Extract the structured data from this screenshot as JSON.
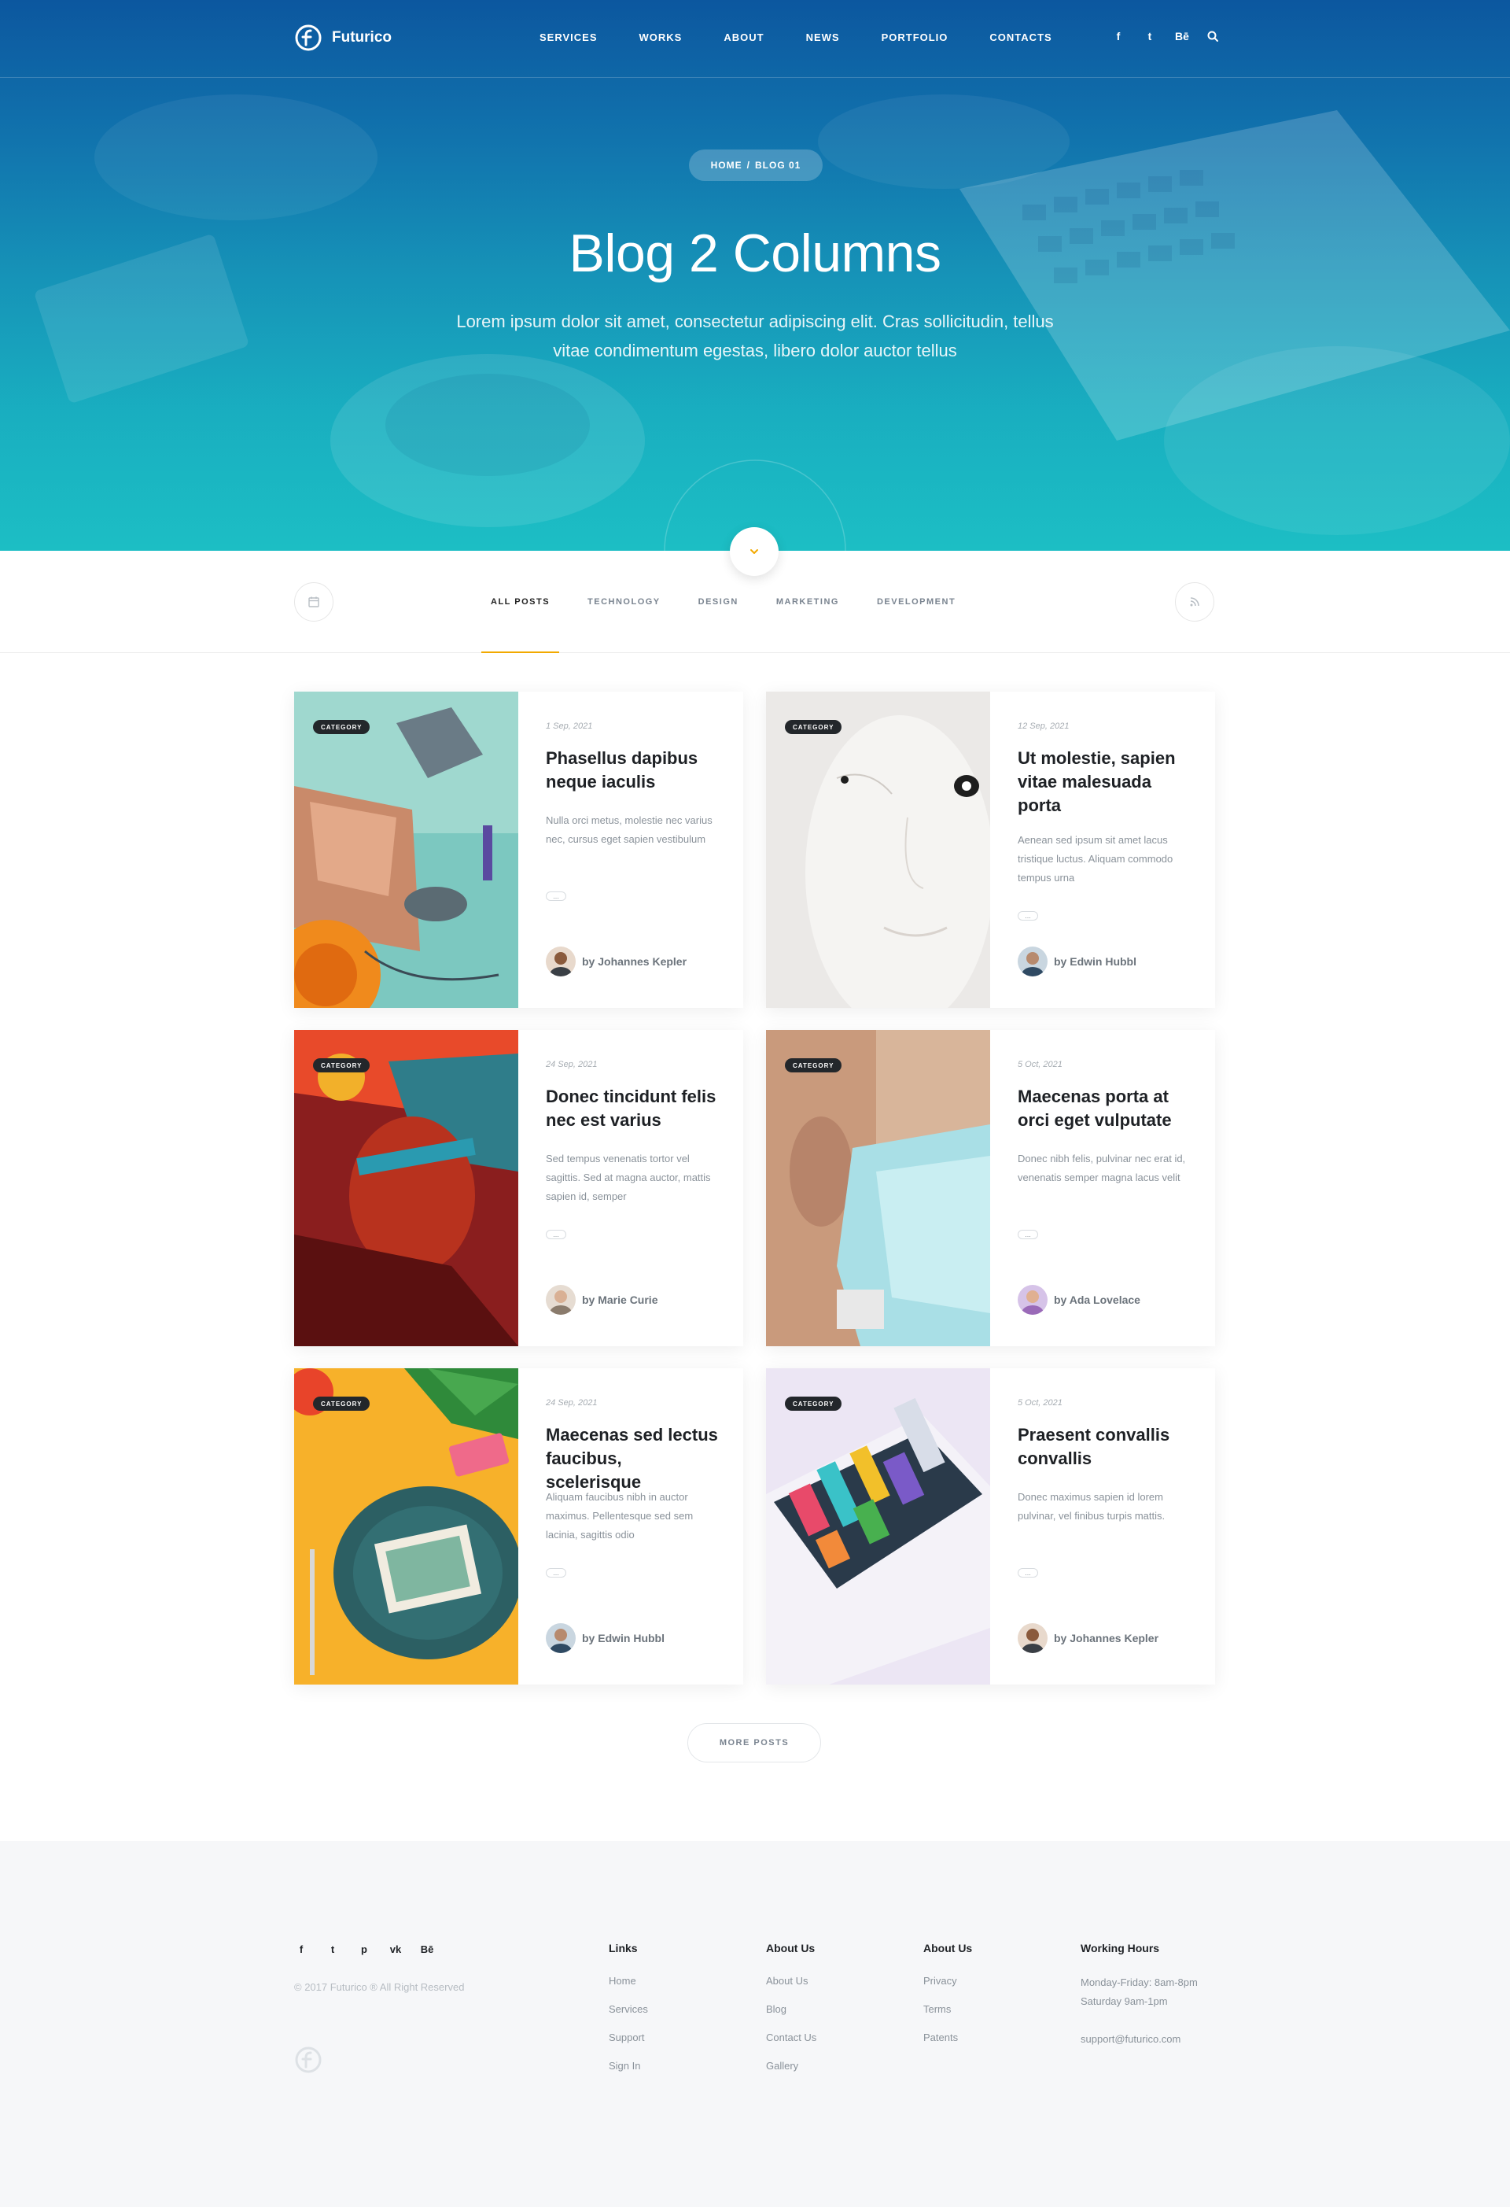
{
  "header": {
    "brand": "Futurico",
    "nav": [
      "SERVICES",
      "WORKS",
      "ABOUT",
      "NEWS",
      "PORTFOLIO",
      "CONTACTS"
    ],
    "social": [
      "f",
      "t",
      "Bē"
    ]
  },
  "hero": {
    "breadcrumb_home": "HOME",
    "breadcrumb_sep": "/",
    "breadcrumb_current": "BLOG 01",
    "title": "Blog 2 Columns",
    "subtitle": "Lorem ipsum dolor sit amet, consectetur adipiscing elit. Cras sollicitudin, tellus vitae condimentum egestas, libero dolor auctor tellus"
  },
  "filters": {
    "tabs": [
      "ALL POSTS",
      "TECHNOLOGY",
      "DESIGN",
      "MARKETING",
      "DEVELOPMENT"
    ],
    "active": "ALL POSTS"
  },
  "posts": [
    {
      "category": "CATEGORY",
      "date": "1 Sep, 2021",
      "title": "Phasellus dapibus neque iaculis",
      "excerpt": "Nulla orci metus, molestie nec varius nec, cursus eget sapien vestibulum",
      "author": "by Johannes Kepler"
    },
    {
      "category": "CATEGORY",
      "date": "12 Sep, 2021",
      "title": "Ut molestie, sapien vitae malesuada porta",
      "excerpt": "Aenean sed ipsum sit amet lacus tristique luctus. Aliquam commodo tempus urna",
      "author": "by Edwin Hubbl"
    },
    {
      "category": "CATEGORY",
      "date": "24 Sep, 2021",
      "title": "Donec tincidunt felis nec est varius",
      "excerpt": "Sed tempus venenatis tortor vel sagittis. Sed at magna auctor, mattis sapien id, semper",
      "author": "by Marie Curie"
    },
    {
      "category": "CATEGORY",
      "date": "5 Oct, 2021",
      "title": "Maecenas porta at orci eget vulputate",
      "excerpt": "Donec nibh felis, pulvinar nec erat id, venenatis semper magna lacus velit",
      "author": "by Ada Lovelace"
    },
    {
      "category": "CATEGORY",
      "date": "24 Sep, 2021",
      "title": "Maecenas sed lectus faucibus, scelerisque",
      "excerpt": "Aliquam faucibus nibh in auctor maximus. Pellentesque sed sem lacinia, sagittis odio",
      "author": "by Edwin Hubbl"
    },
    {
      "category": "CATEGORY",
      "date": "5 Oct, 2021",
      "title": "Praesent convallis convallis",
      "excerpt": "Donec maximus sapien id lorem pulvinar, vel finibus turpis mattis.",
      "author": "by Johannes Kepler"
    }
  ],
  "more_posts": "MORE POSTS",
  "more_dots": "...",
  "footer": {
    "social": [
      "f",
      "t",
      "p",
      "vk",
      "Bē"
    ],
    "copyright": "© 2017 Futurico ® All Right Reserved",
    "columns": [
      {
        "title": "Links",
        "items": [
          "Home",
          "Services",
          "Support",
          "Sign In"
        ]
      },
      {
        "title": "About Us",
        "items": [
          "About Us",
          "Blog",
          "Contact Us",
          "Gallery"
        ]
      },
      {
        "title": "About Us",
        "items": [
          "Privacy",
          "Terms",
          "Patents"
        ]
      }
    ],
    "hours": {
      "title": "Working Hours",
      "line1": "Monday-Friday: 8am-8pm",
      "line2": "Saturday 9am-1pm",
      "email": "support@futurico.com"
    }
  },
  "colors": {
    "accent": "#f2a900",
    "hero_top": "#0d5fa8",
    "hero_bottom": "#1cbec4",
    "link": "#1b6fb8"
  },
  "icons": {
    "calendar": "calendar-icon",
    "rss": "rss-icon",
    "scroll": "chevron-down-icon",
    "search": "search-icon"
  }
}
